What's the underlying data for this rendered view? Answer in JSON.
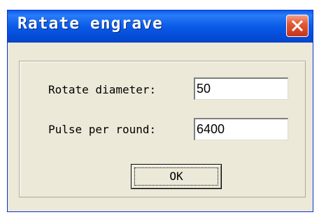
{
  "window": {
    "title": "Ratate engrave",
    "close_icon": "close-icon"
  },
  "form": {
    "rotate_diameter_label": "Rotate diameter:",
    "rotate_diameter_value": "50",
    "pulse_per_round_label": "Pulse per round:",
    "pulse_per_round_value": "6400",
    "ok_label": "OK"
  },
  "colors": {
    "titlebar": "#0a5dea",
    "window_bg": "#ece9d8",
    "close_button": "#e35a35"
  }
}
